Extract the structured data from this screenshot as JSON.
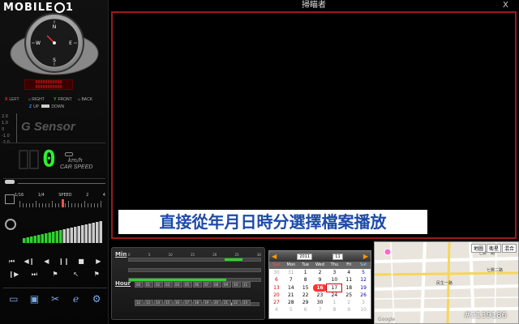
{
  "app": {
    "logo": "MOBILE",
    "title": "掃瞄者",
    "close": "X"
  },
  "compass": {
    "n": "N",
    "e": "E",
    "s": "S",
    "w": "W"
  },
  "gps_readout": [
    "00000000000",
    "00000000000"
  ],
  "axes": {
    "x_label": "LEFT",
    "x_right": "RIGHT",
    "y_label": "FRONT",
    "y_back": "BACK",
    "z_up": "UP",
    "z_down": "DOWN"
  },
  "gsensor": {
    "label": "G Sensor",
    "scale": [
      "2.0",
      "1.0",
      "0",
      "-1.0",
      "-2.0"
    ]
  },
  "speed": {
    "value": "0",
    "unit": "km/h",
    "label": "CAR SPEED"
  },
  "playback_speed": {
    "ticks": [
      "1/16",
      "1/4",
      "SPEED",
      "2",
      "4"
    ]
  },
  "caption": "直接從年月日時分選擇檔案播放",
  "timepanel": {
    "min_label": "Min",
    "min_ticks": [
      "0",
      "5",
      "10",
      "15",
      "20",
      "25",
      "30"
    ],
    "hour_label": "Hour",
    "hours_row1": [
      "00",
      "01",
      "02",
      "03",
      "04",
      "05",
      "06",
      "07",
      "08",
      "09",
      "10",
      "11"
    ],
    "hours_row2": [
      "12",
      "13",
      "14",
      "15",
      "16",
      "17",
      "18",
      "19",
      "20",
      "21",
      "22",
      "23"
    ]
  },
  "calendar": {
    "year": "2011",
    "month": "11",
    "dow": [
      "Sun",
      "Mon",
      "Tue",
      "Wed",
      "Thu",
      "Fri",
      "Sat"
    ],
    "weeks": [
      [
        "30",
        "31",
        "1",
        "2",
        "3",
        "4",
        "5"
      ],
      [
        "6",
        "7",
        "8",
        "9",
        "10",
        "11",
        "12"
      ],
      [
        "13",
        "14",
        "15",
        "16",
        "17",
        "18",
        "19"
      ],
      [
        "20",
        "21",
        "22",
        "23",
        "24",
        "25",
        "26"
      ],
      [
        "27",
        "28",
        "29",
        "30",
        "1",
        "2",
        "3"
      ],
      [
        "4",
        "5",
        "6",
        "7",
        "8",
        "9",
        "10"
      ]
    ],
    "selected": "16",
    "today": "17"
  },
  "map": {
    "btn_map": "地圖",
    "btn_sat": "衛星",
    "btn_mix": "混合",
    "streets": [
      "七賢一路",
      "民生一路",
      "七賢二路"
    ],
    "provider": "Google"
  },
  "watermark": "#2139186",
  "colors": {
    "video_border": "#9a1b1b",
    "speed_green": "#2bf22b",
    "caption_blue": "#1e4aa8",
    "meter_green": "#2fd12f"
  }
}
